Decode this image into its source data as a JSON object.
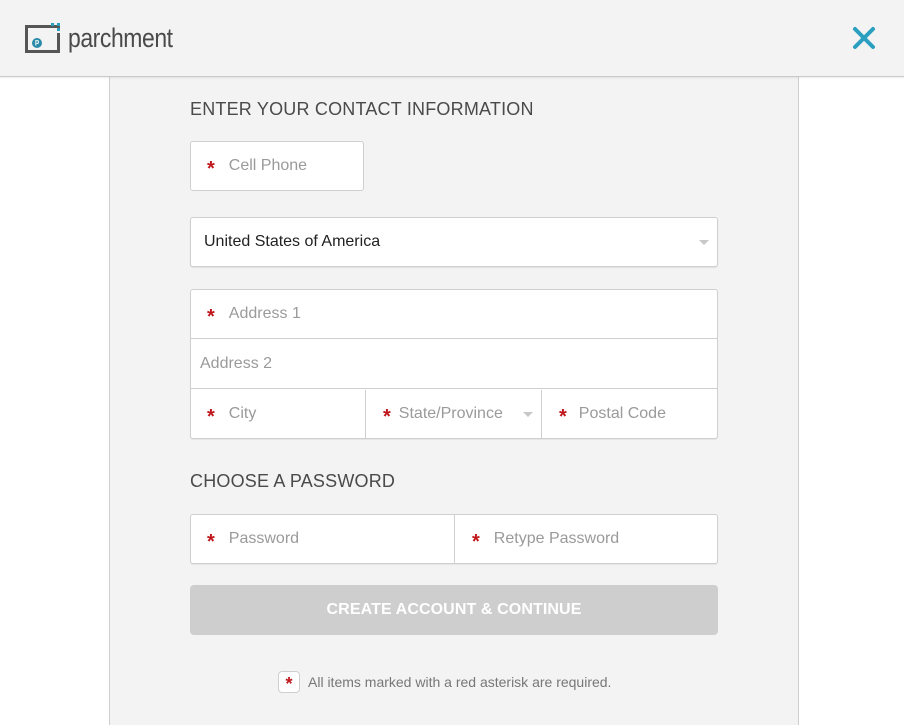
{
  "header": {
    "logo_text": "parchment",
    "logo_mark_letter": "p",
    "close_icon": "close-icon",
    "accent_color": "#2a9fbf"
  },
  "contact": {
    "title": "ENTER YOUR CONTACT INFORMATION",
    "cell_phone_placeholder": "Cell Phone",
    "country_value": "United States of America",
    "address1_placeholder": "Address 1",
    "address2_placeholder": "Address 2",
    "city_placeholder": "City",
    "state_placeholder": "State/Province",
    "postal_placeholder": "Postal Code"
  },
  "password": {
    "title": "CHOOSE A PASSWORD",
    "password_placeholder": "Password",
    "retype_placeholder": "Retype Password"
  },
  "submit_label": "CREATE ACCOUNT & CONTINUE",
  "required_marker": "*",
  "required_note": "All items marked with a red asterisk are required.",
  "colors": {
    "required": "#c0151b",
    "button_disabled": "#cecece"
  }
}
